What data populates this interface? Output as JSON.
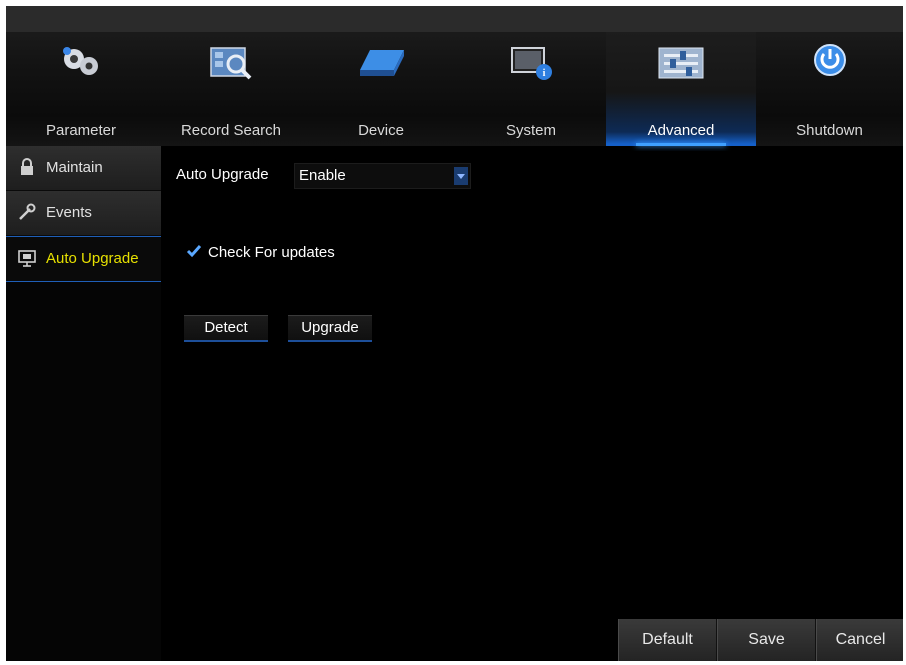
{
  "nav": {
    "tabs": [
      {
        "label": "Parameter",
        "icon": "gears-icon"
      },
      {
        "label": "Record Search",
        "icon": "record-search-icon"
      },
      {
        "label": "Device",
        "icon": "hard-drive-icon"
      },
      {
        "label": "System",
        "icon": "system-info-icon"
      },
      {
        "label": "Advanced",
        "icon": "sliders-icon"
      },
      {
        "label": "Shutdown",
        "icon": "power-icon"
      }
    ],
    "active_tab": "Advanced"
  },
  "sidebar": {
    "items": [
      {
        "label": "Maintain",
        "icon": "lock-icon"
      },
      {
        "label": "Events",
        "icon": "wrench-icon"
      },
      {
        "label": "Auto Upgrade",
        "icon": "upgrade-screen-icon"
      }
    ],
    "active_item": "Auto Upgrade"
  },
  "main": {
    "auto_upgrade_label": "Auto Upgrade",
    "auto_upgrade_value": "Enable",
    "check_updates_label": "Check For updates",
    "check_updates_checked": true,
    "detect_label": "Detect",
    "upgrade_label": "Upgrade"
  },
  "footer": {
    "default_label": "Default",
    "save_label": "Save",
    "cancel_label": "Cancel"
  },
  "colors": {
    "accent": "#1560c9",
    "active_sidebar_text": "#e6e000",
    "background": "#000000"
  }
}
